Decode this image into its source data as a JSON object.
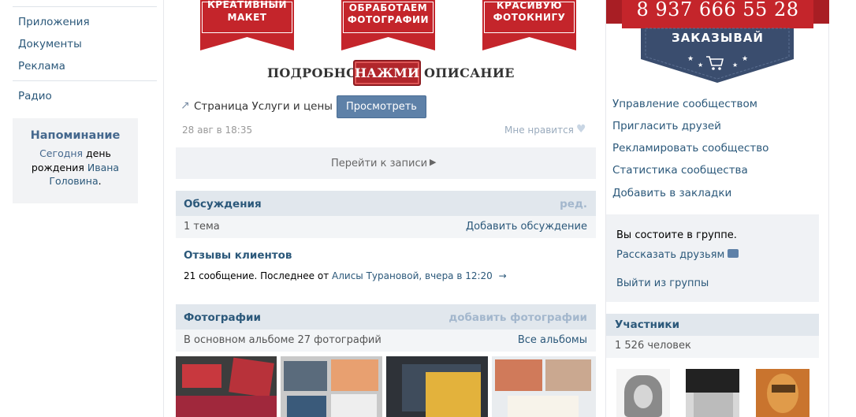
{
  "left_nav": {
    "items": [
      "Приложения",
      "Документы",
      "Реклама"
    ],
    "radio": "Радио"
  },
  "reminder": {
    "title": "Напоминание",
    "text_1": "Сегодня",
    "text_2": "день",
    "text_3": "рождения",
    "text_4": "Ивана Головина",
    "text_5": "."
  },
  "banner": {
    "ribbon_1": [
      "КРЕАТИВНЫЙ",
      "МАКЕТ"
    ],
    "ribbon_2": [
      "ОБРАБОТАЕМ",
      "ФОТОГРАФИИ"
    ],
    "ribbon_3": [
      "КРАСИВУЮ",
      "ФОТОКНИГУ"
    ],
    "caption_left": "ПОДРОБНОЕ",
    "caption_button": "НАЖМИ",
    "caption_right": "ОПИСАНИЕ",
    "phone": "8 937 666 55 28",
    "order": "ЗАКАЗЫВАЙ",
    "colors": {
      "ribbon": "#c4252b",
      "navy": "#3a4d6e"
    }
  },
  "post": {
    "page_link": "Страница Услуги и цены",
    "view_button": "Просмотреть",
    "date": "28 авг в 18:35",
    "like": "Мне нравится",
    "goto": "Перейти к записи"
  },
  "discussions": {
    "title": "Обсуждения",
    "edit": "ред.",
    "count": "1 тема",
    "add": "Добавить обсуждение",
    "topic_title": "Отзывы клиентов",
    "topic_meta_1": "21 сообщение. Последнее от",
    "topic_author": "Алисы Турановой",
    "topic_meta_2": ", вчера в 12:20",
    "arrow": "→"
  },
  "photos": {
    "title": "Фотографии",
    "add": "добавить фотографии",
    "info": "В основном альбоме 27 фотографий",
    "all": "Все альбомы"
  },
  "right_menu": {
    "items": [
      "Управление сообществом",
      "Пригласить друзей",
      "Рекламировать сообщество",
      "Статистика сообщества",
      "Добавить в закладки"
    ]
  },
  "membership": {
    "status": "Вы состоите в группе.",
    "tell": "Рассказать друзьям",
    "leave": "Выйти из группы"
  },
  "members": {
    "title": "Участники",
    "count": "1 526 человек"
  },
  "icons": [
    "share-arrow-icon",
    "heart-icon",
    "chevron-right-icon",
    "speech-bubble-icon",
    "cart-icon",
    "star-icon"
  ]
}
